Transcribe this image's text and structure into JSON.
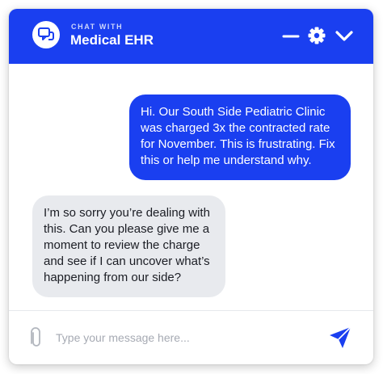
{
  "colors": {
    "brand_blue": "#1a3ff0",
    "agent_bubble": "#e8eaee",
    "placeholder": "#a6aab3"
  },
  "header": {
    "eyebrow": "CHAT WITH",
    "title": "Medical EHR",
    "logo_icon": "chat-bubbles-icon",
    "buttons": [
      {
        "icon": "minimize-icon"
      },
      {
        "icon": "gear-icon"
      },
      {
        "icon": "chevron-down-icon"
      }
    ]
  },
  "messages": [
    {
      "sender": "user",
      "lines": [
        "Hi. Our South Side Pediatric Clinic",
        "was charged 3x the contracted rate",
        "for November. This is frustrating. Fix",
        "this or help me understand why."
      ]
    },
    {
      "sender": "agent",
      "lines": [
        "I’m so sorry you’re dealing with",
        "this. Can you please give me a",
        "moment to review the charge",
        "and see if I can uncover what’s",
        "happening from our side?"
      ]
    }
  ],
  "composer": {
    "placeholder": "Type your message here...",
    "value": "",
    "attach_icon": "paperclip-icon",
    "send_icon": "send-icon"
  }
}
